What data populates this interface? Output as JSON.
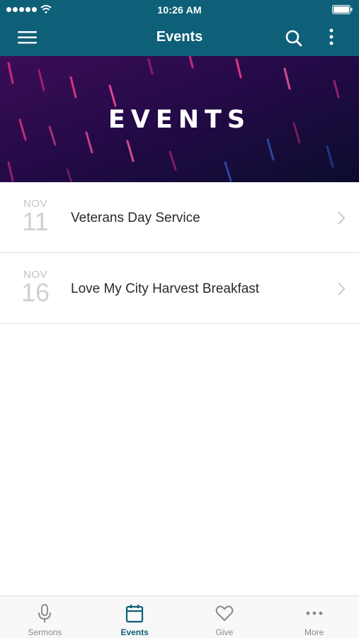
{
  "status_bar": {
    "time": "10:26 AM"
  },
  "nav": {
    "title": "Events"
  },
  "hero": {
    "title": "EVENTS"
  },
  "events": [
    {
      "month": "NOV",
      "day": "11",
      "title": "Veterans Day Service"
    },
    {
      "month": "NOV",
      "day": "16",
      "title": "Love My City Harvest Breakfast"
    }
  ],
  "tabs": [
    {
      "label": "Sermons",
      "icon": "microphone-icon",
      "active": false
    },
    {
      "label": "Events",
      "icon": "calendar-icon",
      "active": true
    },
    {
      "label": "Give",
      "icon": "heart-icon",
      "active": false
    },
    {
      "label": "More",
      "icon": "ellipsis-icon",
      "active": false
    }
  ],
  "colors": {
    "brand": "#0e6078",
    "hero_start": "#3c0d58",
    "hero_end": "#0b0c2e",
    "inactive_tab": "#8a8a8a"
  }
}
